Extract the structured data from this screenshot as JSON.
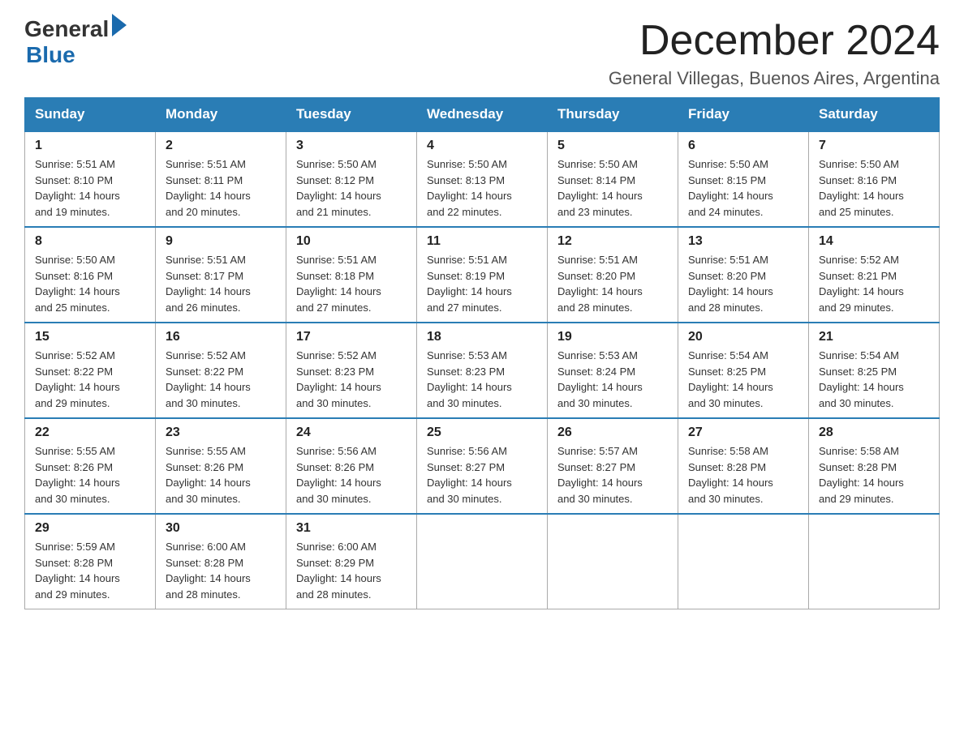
{
  "logo": {
    "general": "General",
    "blue": "Blue"
  },
  "title": "December 2024",
  "subtitle": "General Villegas, Buenos Aires, Argentina",
  "days_of_week": [
    "Sunday",
    "Monday",
    "Tuesday",
    "Wednesday",
    "Thursday",
    "Friday",
    "Saturday"
  ],
  "weeks": [
    [
      {
        "day": "1",
        "sunrise": "5:51 AM",
        "sunset": "8:10 PM",
        "daylight": "14 hours and 19 minutes."
      },
      {
        "day": "2",
        "sunrise": "5:51 AM",
        "sunset": "8:11 PM",
        "daylight": "14 hours and 20 minutes."
      },
      {
        "day": "3",
        "sunrise": "5:50 AM",
        "sunset": "8:12 PM",
        "daylight": "14 hours and 21 minutes."
      },
      {
        "day": "4",
        "sunrise": "5:50 AM",
        "sunset": "8:13 PM",
        "daylight": "14 hours and 22 minutes."
      },
      {
        "day": "5",
        "sunrise": "5:50 AM",
        "sunset": "8:14 PM",
        "daylight": "14 hours and 23 minutes."
      },
      {
        "day": "6",
        "sunrise": "5:50 AM",
        "sunset": "8:15 PM",
        "daylight": "14 hours and 24 minutes."
      },
      {
        "day": "7",
        "sunrise": "5:50 AM",
        "sunset": "8:16 PM",
        "daylight": "14 hours and 25 minutes."
      }
    ],
    [
      {
        "day": "8",
        "sunrise": "5:50 AM",
        "sunset": "8:16 PM",
        "daylight": "14 hours and 25 minutes."
      },
      {
        "day": "9",
        "sunrise": "5:51 AM",
        "sunset": "8:17 PM",
        "daylight": "14 hours and 26 minutes."
      },
      {
        "day": "10",
        "sunrise": "5:51 AM",
        "sunset": "8:18 PM",
        "daylight": "14 hours and 27 minutes."
      },
      {
        "day": "11",
        "sunrise": "5:51 AM",
        "sunset": "8:19 PM",
        "daylight": "14 hours and 27 minutes."
      },
      {
        "day": "12",
        "sunrise": "5:51 AM",
        "sunset": "8:20 PM",
        "daylight": "14 hours and 28 minutes."
      },
      {
        "day": "13",
        "sunrise": "5:51 AM",
        "sunset": "8:20 PM",
        "daylight": "14 hours and 28 minutes."
      },
      {
        "day": "14",
        "sunrise": "5:52 AM",
        "sunset": "8:21 PM",
        "daylight": "14 hours and 29 minutes."
      }
    ],
    [
      {
        "day": "15",
        "sunrise": "5:52 AM",
        "sunset": "8:22 PM",
        "daylight": "14 hours and 29 minutes."
      },
      {
        "day": "16",
        "sunrise": "5:52 AM",
        "sunset": "8:22 PM",
        "daylight": "14 hours and 30 minutes."
      },
      {
        "day": "17",
        "sunrise": "5:52 AM",
        "sunset": "8:23 PM",
        "daylight": "14 hours and 30 minutes."
      },
      {
        "day": "18",
        "sunrise": "5:53 AM",
        "sunset": "8:23 PM",
        "daylight": "14 hours and 30 minutes."
      },
      {
        "day": "19",
        "sunrise": "5:53 AM",
        "sunset": "8:24 PM",
        "daylight": "14 hours and 30 minutes."
      },
      {
        "day": "20",
        "sunrise": "5:54 AM",
        "sunset": "8:25 PM",
        "daylight": "14 hours and 30 minutes."
      },
      {
        "day": "21",
        "sunrise": "5:54 AM",
        "sunset": "8:25 PM",
        "daylight": "14 hours and 30 minutes."
      }
    ],
    [
      {
        "day": "22",
        "sunrise": "5:55 AM",
        "sunset": "8:26 PM",
        "daylight": "14 hours and 30 minutes."
      },
      {
        "day": "23",
        "sunrise": "5:55 AM",
        "sunset": "8:26 PM",
        "daylight": "14 hours and 30 minutes."
      },
      {
        "day": "24",
        "sunrise": "5:56 AM",
        "sunset": "8:26 PM",
        "daylight": "14 hours and 30 minutes."
      },
      {
        "day": "25",
        "sunrise": "5:56 AM",
        "sunset": "8:27 PM",
        "daylight": "14 hours and 30 minutes."
      },
      {
        "day": "26",
        "sunrise": "5:57 AM",
        "sunset": "8:27 PM",
        "daylight": "14 hours and 30 minutes."
      },
      {
        "day": "27",
        "sunrise": "5:58 AM",
        "sunset": "8:28 PM",
        "daylight": "14 hours and 30 minutes."
      },
      {
        "day": "28",
        "sunrise": "5:58 AM",
        "sunset": "8:28 PM",
        "daylight": "14 hours and 29 minutes."
      }
    ],
    [
      {
        "day": "29",
        "sunrise": "5:59 AM",
        "sunset": "8:28 PM",
        "daylight": "14 hours and 29 minutes."
      },
      {
        "day": "30",
        "sunrise": "6:00 AM",
        "sunset": "8:28 PM",
        "daylight": "14 hours and 28 minutes."
      },
      {
        "day": "31",
        "sunrise": "6:00 AM",
        "sunset": "8:29 PM",
        "daylight": "14 hours and 28 minutes."
      },
      null,
      null,
      null,
      null
    ]
  ],
  "labels": {
    "sunrise": "Sunrise:",
    "sunset": "Sunset:",
    "daylight": "Daylight:"
  }
}
